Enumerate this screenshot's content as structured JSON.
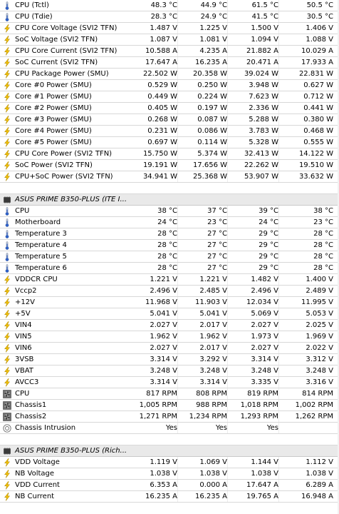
{
  "rows": [
    {
      "type": "sensor",
      "icon": "temp",
      "label": "CPU (Tctl)",
      "values": [
        "48.3 °C",
        "44.9 °C",
        "61.5 °C",
        "50.5 °C"
      ]
    },
    {
      "type": "sensor",
      "icon": "temp",
      "label": "CPU (Tdie)",
      "values": [
        "28.3 °C",
        "24.9 °C",
        "41.5 °C",
        "30.5 °C"
      ]
    },
    {
      "type": "sensor",
      "icon": "bolt",
      "label": "CPU Core Voltage (SVI2 TFN)",
      "values": [
        "1.487 V",
        "1.225 V",
        "1.500 V",
        "1.406 V"
      ]
    },
    {
      "type": "sensor",
      "icon": "bolt",
      "label": "SoC Voltage (SVI2 TFN)",
      "values": [
        "1.087 V",
        "1.081 V",
        "1.094 V",
        "1.088 V"
      ]
    },
    {
      "type": "sensor",
      "icon": "bolt",
      "label": "CPU Core Current (SVI2 TFN)",
      "values": [
        "10.588 A",
        "4.235 A",
        "21.882 A",
        "10.029 A"
      ]
    },
    {
      "type": "sensor",
      "icon": "bolt",
      "label": "SoC Current (SVI2 TFN)",
      "values": [
        "17.647 A",
        "16.235 A",
        "20.471 A",
        "17.933 A"
      ]
    },
    {
      "type": "sensor",
      "icon": "bolt",
      "label": "CPU Package Power (SMU)",
      "values": [
        "22.502 W",
        "20.358 W",
        "39.024 W",
        "22.831 W"
      ]
    },
    {
      "type": "sensor",
      "icon": "bolt",
      "label": "Core #0 Power (SMU)",
      "values": [
        "0.529 W",
        "0.250 W",
        "3.948 W",
        "0.627 W"
      ]
    },
    {
      "type": "sensor",
      "icon": "bolt",
      "label": "Core #1 Power (SMU)",
      "values": [
        "0.449 W",
        "0.224 W",
        "7.623 W",
        "0.712 W"
      ]
    },
    {
      "type": "sensor",
      "icon": "bolt",
      "label": "Core #2 Power (SMU)",
      "values": [
        "0.405 W",
        "0.197 W",
        "2.336 W",
        "0.441 W"
      ]
    },
    {
      "type": "sensor",
      "icon": "bolt",
      "label": "Core #3 Power (SMU)",
      "values": [
        "0.268 W",
        "0.087 W",
        "5.288 W",
        "0.380 W"
      ]
    },
    {
      "type": "sensor",
      "icon": "bolt",
      "label": "Core #4 Power (SMU)",
      "values": [
        "0.231 W",
        "0.086 W",
        "3.783 W",
        "0.468 W"
      ]
    },
    {
      "type": "sensor",
      "icon": "bolt",
      "label": "Core #5 Power (SMU)",
      "values": [
        "0.697 W",
        "0.114 W",
        "5.328 W",
        "0.555 W"
      ]
    },
    {
      "type": "sensor",
      "icon": "bolt",
      "label": "CPU Core Power (SVI2 TFN)",
      "values": [
        "15.750 W",
        "5.374 W",
        "32.413 W",
        "14.122 W"
      ]
    },
    {
      "type": "sensor",
      "icon": "bolt",
      "label": "SoC Power (SVI2 TFN)",
      "values": [
        "19.191 W",
        "17.656 W",
        "22.262 W",
        "19.510 W"
      ]
    },
    {
      "type": "sensor",
      "icon": "bolt",
      "label": "CPU+SoC Power (SVI2 TFN)",
      "values": [
        "34.941 W",
        "25.368 W",
        "53.907 W",
        "33.632 W"
      ]
    },
    {
      "type": "blank"
    },
    {
      "type": "header",
      "icon": "chip",
      "label": "ASUS PRIME B350-PLUS (ITE I..."
    },
    {
      "type": "sensor",
      "icon": "temp",
      "label": "CPU",
      "values": [
        "38 °C",
        "37 °C",
        "39 °C",
        "38 °C"
      ]
    },
    {
      "type": "sensor",
      "icon": "temp",
      "label": "Motherboard",
      "values": [
        "24 °C",
        "23 °C",
        "24 °C",
        "23 °C"
      ]
    },
    {
      "type": "sensor",
      "icon": "temp",
      "label": "Temperature 3",
      "values": [
        "28 °C",
        "27 °C",
        "29 °C",
        "28 °C"
      ]
    },
    {
      "type": "sensor",
      "icon": "temp",
      "label": "Temperature 4",
      "values": [
        "28 °C",
        "27 °C",
        "29 °C",
        "28 °C"
      ]
    },
    {
      "type": "sensor",
      "icon": "temp",
      "label": "Temperature 5",
      "values": [
        "28 °C",
        "27 °C",
        "29 °C",
        "28 °C"
      ]
    },
    {
      "type": "sensor",
      "icon": "temp",
      "label": "Temperature 6",
      "values": [
        "28 °C",
        "27 °C",
        "29 °C",
        "28 °C"
      ]
    },
    {
      "type": "sensor",
      "icon": "bolt",
      "label": "VDDCR CPU",
      "values": [
        "1.221 V",
        "1.221 V",
        "1.482 V",
        "1.400 V"
      ]
    },
    {
      "type": "sensor",
      "icon": "bolt",
      "label": "Vccp2",
      "values": [
        "2.496 V",
        "2.485 V",
        "2.496 V",
        "2.489 V"
      ]
    },
    {
      "type": "sensor",
      "icon": "bolt",
      "label": "+12V",
      "values": [
        "11.968 V",
        "11.903 V",
        "12.034 V",
        "11.995 V"
      ]
    },
    {
      "type": "sensor",
      "icon": "bolt",
      "label": "+5V",
      "values": [
        "5.041 V",
        "5.041 V",
        "5.069 V",
        "5.053 V"
      ]
    },
    {
      "type": "sensor",
      "icon": "bolt",
      "label": "VIN4",
      "values": [
        "2.027 V",
        "2.017 V",
        "2.027 V",
        "2.025 V"
      ]
    },
    {
      "type": "sensor",
      "icon": "bolt",
      "label": "VIN5",
      "values": [
        "1.962 V",
        "1.962 V",
        "1.973 V",
        "1.969 V"
      ]
    },
    {
      "type": "sensor",
      "icon": "bolt",
      "label": "VIN6",
      "values": [
        "2.027 V",
        "2.017 V",
        "2.027 V",
        "2.022 V"
      ]
    },
    {
      "type": "sensor",
      "icon": "bolt",
      "label": "3VSB",
      "values": [
        "3.314 V",
        "3.292 V",
        "3.314 V",
        "3.312 V"
      ]
    },
    {
      "type": "sensor",
      "icon": "bolt",
      "label": "VBAT",
      "values": [
        "3.248 V",
        "3.248 V",
        "3.248 V",
        "3.248 V"
      ]
    },
    {
      "type": "sensor",
      "icon": "bolt",
      "label": "AVCC3",
      "values": [
        "3.314 V",
        "3.314 V",
        "3.335 V",
        "3.316 V"
      ]
    },
    {
      "type": "sensor",
      "icon": "fan",
      "label": "CPU",
      "values": [
        "817 RPM",
        "808 RPM",
        "819 RPM",
        "814 RPM"
      ]
    },
    {
      "type": "sensor",
      "icon": "fan",
      "label": "Chassis1",
      "values": [
        "1,005 RPM",
        "988 RPM",
        "1,018 RPM",
        "1,002 RPM"
      ]
    },
    {
      "type": "sensor",
      "icon": "fan",
      "label": "Chassis2",
      "values": [
        "1,271 RPM",
        "1,234 RPM",
        "1,293 RPM",
        "1,262 RPM"
      ]
    },
    {
      "type": "sensor",
      "icon": "intrusion",
      "label": "Chassis Intrusion",
      "values": [
        "Yes",
        "Yes",
        "Yes",
        ""
      ]
    },
    {
      "type": "blank"
    },
    {
      "type": "header",
      "icon": "chip",
      "label": "ASUS PRIME B350-PLUS (Rich..."
    },
    {
      "type": "sensor",
      "icon": "bolt",
      "label": "VDD Voltage",
      "values": [
        "1.119 V",
        "1.069 V",
        "1.144 V",
        "1.112 V"
      ]
    },
    {
      "type": "sensor",
      "icon": "bolt",
      "label": "NB Voltage",
      "values": [
        "1.038 V",
        "1.038 V",
        "1.038 V",
        "1.038 V"
      ]
    },
    {
      "type": "sensor",
      "icon": "bolt",
      "label": "VDD Current",
      "values": [
        "6.353 A",
        "0.000 A",
        "17.647 A",
        "6.289 A"
      ]
    },
    {
      "type": "sensor",
      "icon": "bolt",
      "label": "NB Current",
      "values": [
        "16.235 A",
        "16.235 A",
        "19.765 A",
        "16.948 A"
      ]
    }
  ]
}
